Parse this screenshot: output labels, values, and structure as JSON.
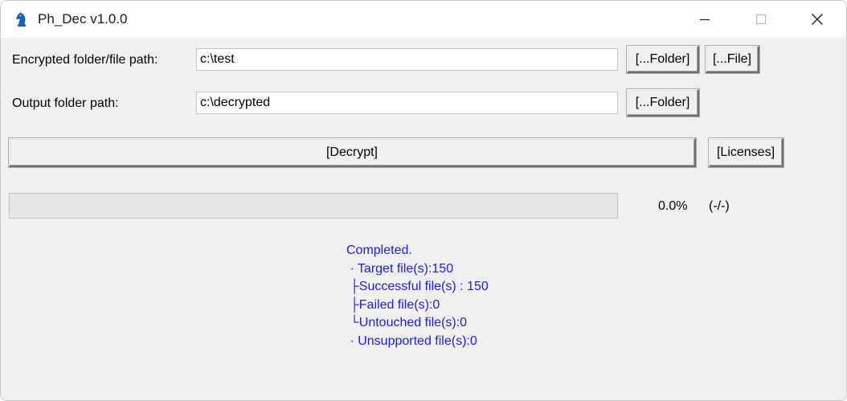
{
  "window": {
    "title": "Ph_Dec v1.0.0"
  },
  "form": {
    "encrypted_label": "Encrypted folder/file path:",
    "encrypted_value": "c:\\test",
    "encrypted_folder_btn": "[...Folder]",
    "encrypted_file_btn": "[...File]",
    "output_label": "Output folder path:",
    "output_value": "c:\\decrypted",
    "output_folder_btn": "[...Folder]",
    "decrypt_btn": "[Decrypt]",
    "licenses_btn": "[Licenses]"
  },
  "progress": {
    "fraction": 0.0,
    "percent_text": "0.0%",
    "count_text": "(-/-)"
  },
  "status": {
    "lines": [
      "Completed.",
      " · Target file(s):150",
      " ├Successful file(s) : 150",
      " ├Failed file(s):0",
      " └Untouched file(s):0",
      " · Unsupported file(s):0"
    ]
  },
  "icons": {
    "app": "chess-knight-icon",
    "minimize": "minimize-icon",
    "maximize": "maximize-icon",
    "close": "close-icon"
  },
  "colors": {
    "status_text": "#1c1ce6",
    "progress_fill": "#06b025",
    "app_icon": "#1e5fb4"
  }
}
